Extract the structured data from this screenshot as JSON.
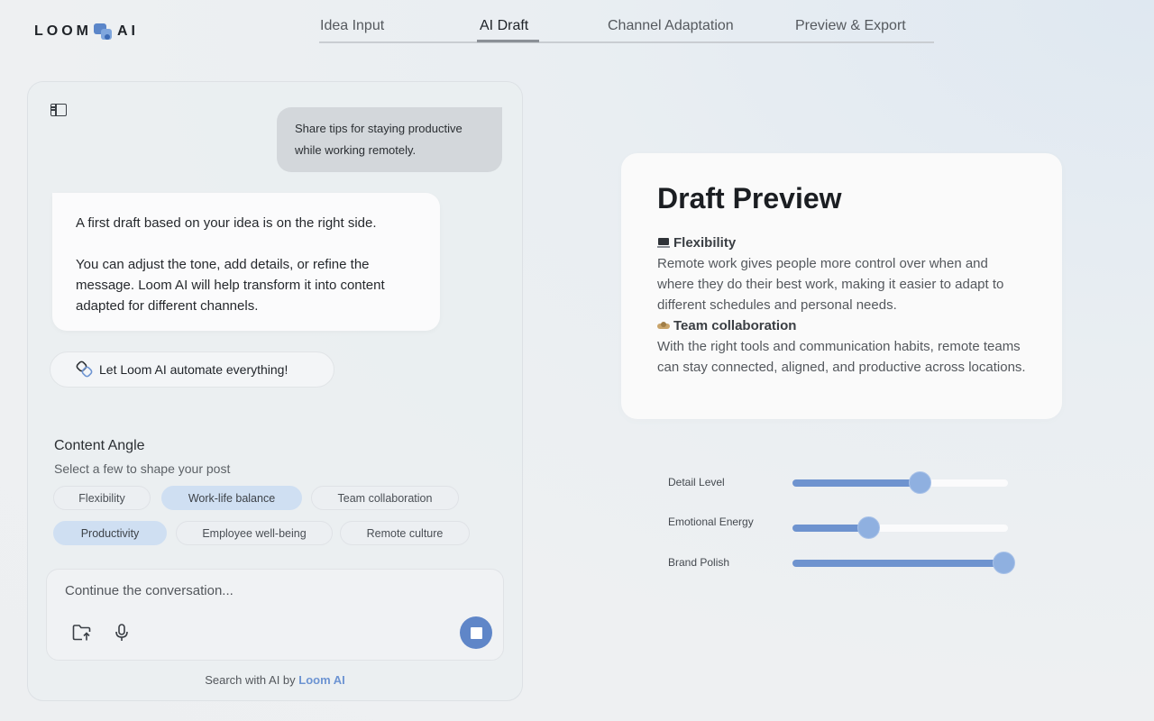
{
  "logo": {
    "left": "LOOM",
    "right": "AI"
  },
  "tabs": [
    {
      "label": "Idea Input"
    },
    {
      "label": "AI Draft"
    },
    {
      "label": "Channel Adaptation"
    },
    {
      "label": "Preview & Export"
    }
  ],
  "active_tab": "AI Draft",
  "chat": {
    "user_message": "Share tips for staying productive while working remotely.",
    "ai_message_1": "A first draft based on your idea is on the right side.",
    "ai_message_2": "You can adjust the tone, add details, or refine the message. Loom AI will help transform it into content adapted for different channels.",
    "automate_label": "Let Loom AI automate everything!"
  },
  "content_angle": {
    "title": "Content Angle",
    "subtitle": "Select a few to shape your post",
    "chips": [
      {
        "label": "Flexibility",
        "selected": false
      },
      {
        "label": "Work-life balance",
        "selected": true
      },
      {
        "label": "Team collaboration",
        "selected": false
      },
      {
        "label": "Productivity",
        "selected": true
      },
      {
        "label": "Employee well-being",
        "selected": false
      },
      {
        "label": "Remote culture",
        "selected": false
      }
    ]
  },
  "composer": {
    "placeholder": "Continue the conversation...",
    "icons": [
      "folder-upload-icon",
      "microphone-icon",
      "stop-icon"
    ]
  },
  "footer": {
    "prefix": "Search with AI by ",
    "brand": "Loom AI"
  },
  "draft": {
    "title": "Draft Preview",
    "sections": [
      {
        "icon": "laptop-icon",
        "heading": "Flexibility",
        "text": "Remote work gives people more control over when and where they do their best work, making it easier to adapt to different schedules and personal needs."
      },
      {
        "icon": "handshake-icon",
        "heading": "Team collaboration",
        "text": "With the right tools and communication habits, remote teams can stay connected, aligned, and productive across locations."
      }
    ]
  },
  "sliders": [
    {
      "label": "Detail Level",
      "value": 0.59
    },
    {
      "label": "Emotional Energy",
      "value": 0.35
    },
    {
      "label": "Brand Polish",
      "value": 0.98
    }
  ],
  "colors": {
    "accent": "#5f86c8",
    "chip_selected": "#cfdff2"
  }
}
